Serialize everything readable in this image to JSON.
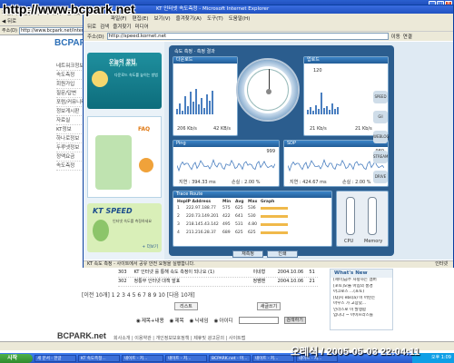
{
  "overlay_url": "http://www.bcpark.net",
  "outer_window": {
    "title": "BCPARK Speed Test - Microsoft Internet Explorer",
    "menu": [
      "파일(F)",
      "편집(E)",
      "보기(V)",
      "즐겨찾기(A)",
      "도구(T)",
      "도움말(H)"
    ],
    "back_label": "뒤로",
    "address_label": "주소(D)",
    "address_value": "http://www.bcpark.net/internet/bb"
  },
  "site": {
    "logo": "BCPARK",
    "side_menu": [
      "네트워크정보",
      "속도측정",
      "회원가입",
      "질문/답변",
      "포럼/커뮤니티",
      "정보게시판",
      "자료실",
      "KT정보",
      "하나로정보",
      "두루넷정보",
      "정액요금",
      "속도측정"
    ]
  },
  "inner_window": {
    "title": "KT 인터넷 속도측정 - Microsoft Internet Explorer",
    "menu": [
      "파일(F)",
      "편집(E)",
      "보기(V)",
      "즐겨찾기(A)",
      "도구(T)",
      "도움말(H)"
    ],
    "toolbar": [
      "뒤로",
      "검색",
      "즐겨찾기",
      "미디어"
    ],
    "address_label": "주소(D)",
    "address_value": "http://speed.kornet.net",
    "go_label": "이동",
    "links_label": "연결",
    "status": "KT 속도 측정 - 사이트에서 공유 안전 요청을 실행합니다.",
    "status_right": "인터넷"
  },
  "sidebar_inner": {
    "today_title": "오늘의 꿀팁",
    "today_sub": "Today's Word!",
    "today_text": "다운로드 속도를 높이는 방법",
    "faq_label": "FAQ",
    "kt_title": "KT SPEED",
    "kt_text": "인터넷 속도를 측정하세요",
    "more": "+ 더보기"
  },
  "speed_test": {
    "header": "속도 측정 · 측정 결과",
    "download_label": "다운로드",
    "download_values": [
      "206 Kb/s",
      "42 KB/s"
    ],
    "upload_label": "업로드",
    "upload_values": [
      "21 Kb/s",
      "21 Kb/s"
    ],
    "gauge_top": "1.1",
    "gauge_right": "120",
    "ping_label": "Ping",
    "ping_value": "999",
    "ping_stats": [
      "지연 : 394.33 ms",
      "손실 : 2.00 %"
    ],
    "sdp_label": "SDP",
    "sdp_value": "989",
    "sdp_stats": [
      "지연 : 424.67 ms",
      "손실 : 2.00 %"
    ],
    "trace_label": "Trace Route",
    "trace_header": [
      "Hop",
      "IP Address",
      "Min",
      "Avg",
      "Max",
      "Graph"
    ],
    "trace_rows": [
      [
        "1",
        "222.97.188.77",
        "575",
        "625",
        "536"
      ],
      [
        "2",
        "220.73.149.201",
        "422",
        "641",
        "530"
      ],
      [
        "3",
        "218.145.43.142",
        "495",
        "531",
        "4.80"
      ],
      [
        "4",
        "211.216.28.37",
        "689",
        "625",
        "625"
      ]
    ],
    "bottom_buttons": [
      "CPU",
      "Memory"
    ],
    "retest": "재측정",
    "print": "인쇄"
  },
  "right_icons": [
    "SPEED",
    "Gil",
    "WEBLOG",
    "STREAM",
    "DRIVE"
  ],
  "board": {
    "rows": [
      {
        "num": "303",
        "title": "KT 인터넷 를 통해 속도 측정이 되나요 (1)",
        "author": "이네형",
        "date": "2004.10.06",
        "views": "51"
      },
      {
        "num": "302",
        "title": "정통부 인터넷 대책 발표",
        "author": "정쌤맨",
        "date": "2004.10.06",
        "views": "21"
      }
    ],
    "pagination": "[이전 10개]  1  2  3  4  5  6  7  8  9  10  [다음 10개]",
    "list_button": "리스트",
    "new_button": "새글쓰기",
    "search_options": [
      "제목+내용",
      "제목",
      "닉네임",
      "아이디"
    ],
    "search_button": "검색하기"
  },
  "whats_new": {
    "title": "What's New",
    "items": [
      "[세이]금주 사랑하는 멤버",
      "[포토]오늘 아침의 풍경",
      "아크로스 ...(포토)",
      "[Q]지 ebs(a) 이 어떤는",
      "마우스 가 고장났...",
      "인라스로 이 발생합",
      "입니다 ~ 아이프라스를"
    ]
  },
  "footer": {
    "logo": "BCPARK.net",
    "links": "회사소개 | 이용약관 | 개인정보보호정책 | 제휴및 광고문의 | 사이트맵"
  },
  "taskbar": {
    "start": "시작",
    "tasks": [
      "세 문서 - 한글",
      "KT 속도측정...",
      "네이트 - 저...",
      "네이트 - 저...",
      "BCPARK.net - 마...",
      "네이트 - 저...",
      "네이트 - 저..."
    ],
    "tray": "오후 1:09"
  },
  "stamp": "오레식 / 2005-05-03 22:04:11"
}
